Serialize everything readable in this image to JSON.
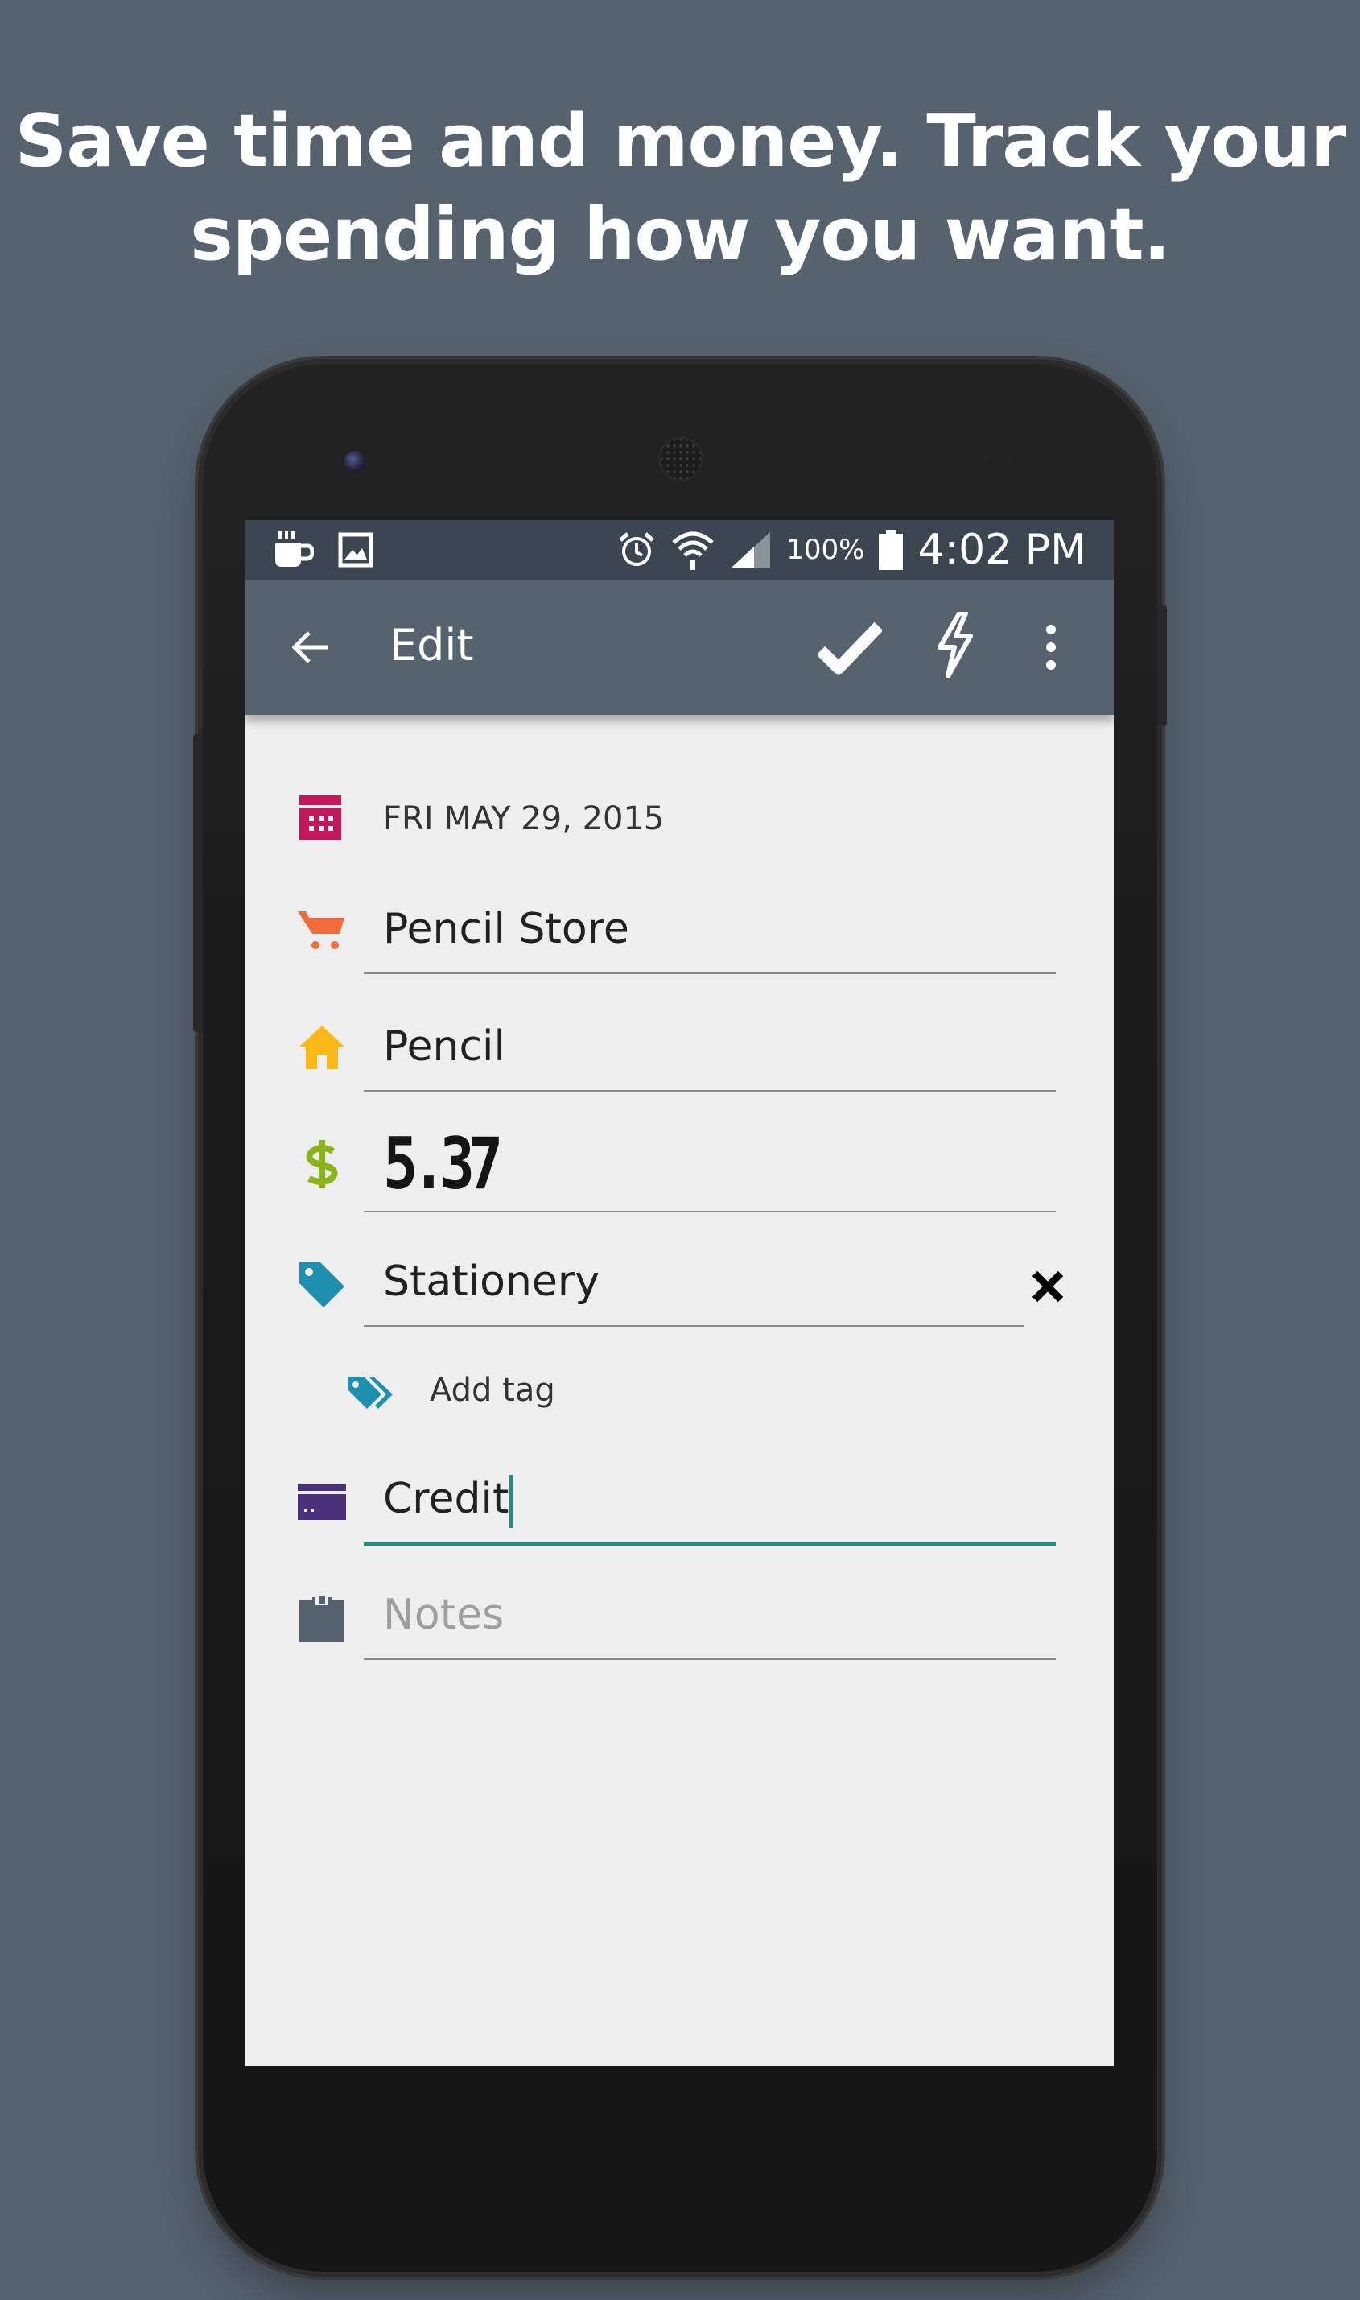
{
  "headline": {
    "line1": "Save time and money. Track your",
    "line2": "spending how you want."
  },
  "status_bar": {
    "left_icons": [
      "coffee-icon",
      "image-icon"
    ],
    "right_icons": [
      "alarm-icon",
      "wifi-icon",
      "signal-icon",
      "battery-icon"
    ],
    "battery": "100%",
    "time": "4:02 PM"
  },
  "toolbar": {
    "title": "Edit",
    "back_icon": "arrow-left-icon",
    "save_icon": "check-icon",
    "quick_icon": "lightning-icon",
    "menu_icon": "more-vertical-icon",
    "color": "#56636f"
  },
  "form": {
    "date": {
      "value": "FRI MAY 29, 2015",
      "icon": "calendar-icon",
      "color": "#c2185b"
    },
    "store": {
      "value": "Pencil Store",
      "icon": "cart-icon",
      "color": "#f26b3a"
    },
    "item": {
      "value": "Pencil",
      "icon": "home-icon",
      "color": "#fbb917"
    },
    "amount": {
      "value": "5.37",
      "icon": "dollar-icon",
      "color": "#8ab41c"
    },
    "tag": {
      "value": "Stationery",
      "icon": "tag-icon",
      "color": "#1f8fb0",
      "clear_icon": "close-icon"
    },
    "add_tag": {
      "label": "Add tag",
      "icon": "tags-icon",
      "color": "#1f8fb0"
    },
    "payment": {
      "value": "Credit",
      "icon": "credit-card-icon",
      "color": "#4a2f7a"
    },
    "notes": {
      "placeholder": "Notes",
      "value": "",
      "icon": "clipboard-icon",
      "color": "#56636f"
    }
  },
  "accent_color": "#1e8c88"
}
